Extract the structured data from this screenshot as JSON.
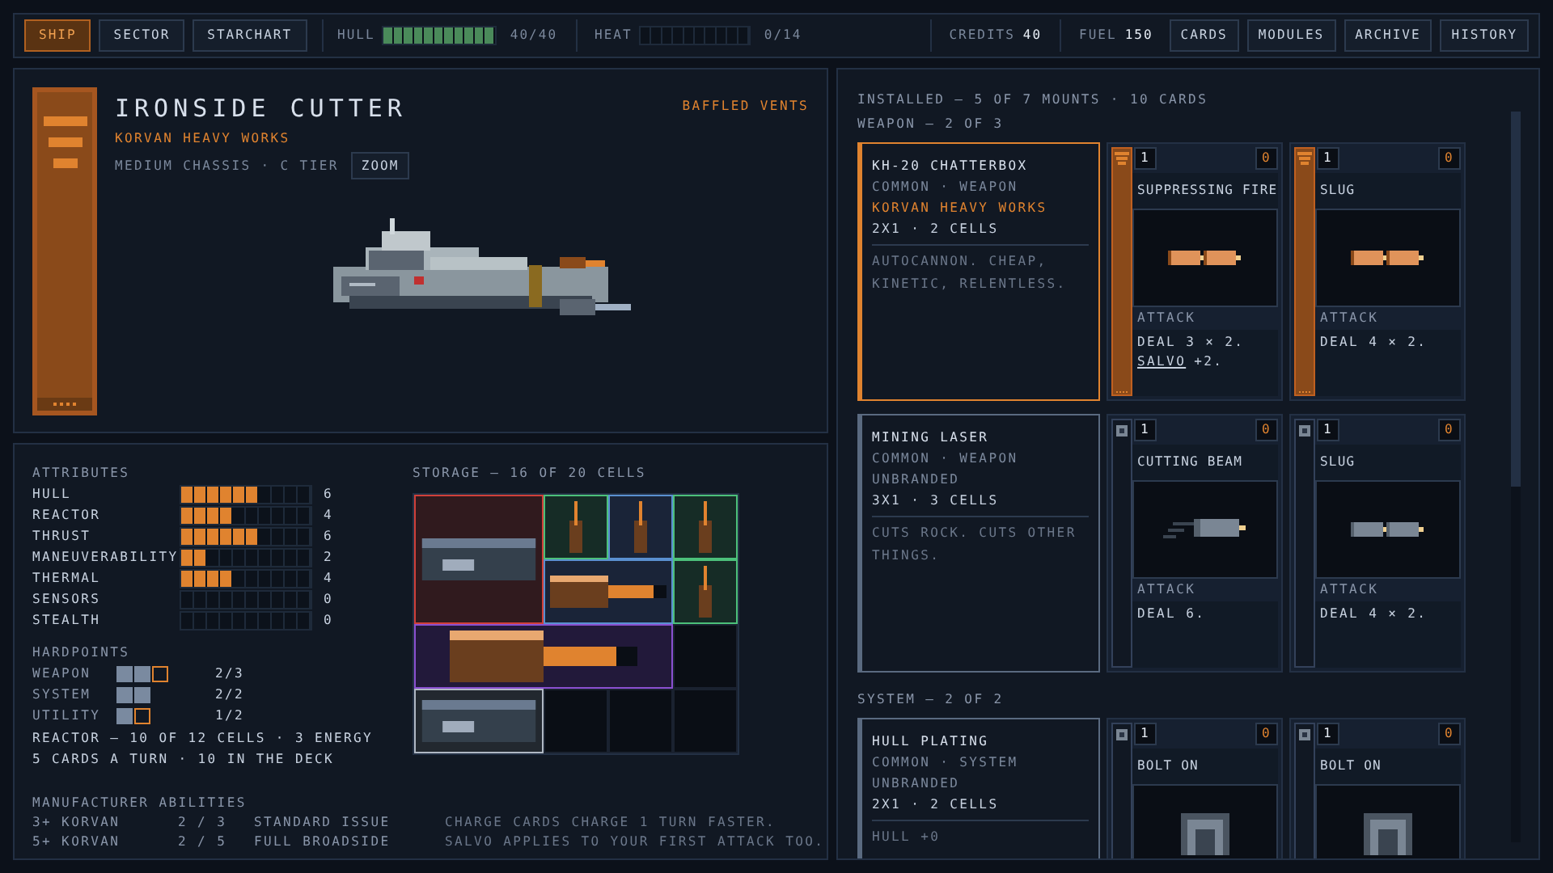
{
  "top_bar": {
    "tabs": [
      {
        "label": "SHIP",
        "selected": true
      },
      {
        "label": "SECTOR",
        "selected": false
      },
      {
        "label": "STARCHART",
        "selected": false
      }
    ],
    "hull": {
      "label": "HULL",
      "level": 1,
      "value": "40/40"
    },
    "heat": {
      "label": "HEAT",
      "level": 0,
      "value": "0/14"
    },
    "credits": {
      "label": "CREDITS",
      "value": "40"
    },
    "fuel": {
      "label": "FUEL",
      "value": "150"
    },
    "buttons": [
      "CARDS",
      "MODULES",
      "ARCHIVE",
      "HISTORY"
    ]
  },
  "ship": {
    "name": "IRONSIDE CUTTER",
    "maker": "KORVAN HEAVY WORKS",
    "chassis": "MEDIUM CHASSIS · C TIER",
    "zoom_button": "ZOOM",
    "trait": "BAFFLED VENTS"
  },
  "attributes": {
    "title": "ATTRIBUTES",
    "items": [
      {
        "name": "HULL",
        "level": 0.6,
        "value": "6"
      },
      {
        "name": "REACTOR",
        "level": 0.4,
        "value": "4"
      },
      {
        "name": "THRUST",
        "level": 0.6,
        "value": "6"
      },
      {
        "name": "MANEUVERABILITY",
        "level": 0.2,
        "value": "2"
      },
      {
        "name": "THERMAL",
        "level": 0.4,
        "value": "4"
      },
      {
        "name": "SENSORS",
        "level": 0,
        "value": "0"
      },
      {
        "name": "STEALTH",
        "level": 0,
        "value": "0"
      }
    ]
  },
  "hardpoints": {
    "title": "HARDPOINTS",
    "items": [
      {
        "name": "WEAPON",
        "slots": [
          {
            "used": true
          },
          {
            "used": true
          },
          {
            "used": false
          }
        ],
        "value": "2/3"
      },
      {
        "name": "SYSTEM",
        "slots": [
          {
            "used": true
          },
          {
            "used": true
          }
        ],
        "value": "2/2"
      },
      {
        "name": "UTILITY",
        "slots": [
          {
            "used": true
          },
          {
            "used": false
          }
        ],
        "value": "1/2"
      }
    ]
  },
  "reactor": "REACTOR — 10 OF 12 CELLS · 3 ENERGY",
  "deck": "5 CARDS A TURN · 10 IN THE DECK",
  "manufacturer": {
    "title": "MANUFACTURER ABILITIES",
    "rows": [
      {
        "name": "3+ KORVAN",
        "count": "2 / 3",
        "ability": "STANDARD ISSUE",
        "description": "CHARGE CARDS CHARGE 1 TURN FASTER."
      },
      {
        "name": "5+ KORVAN",
        "count": "2 / 5",
        "ability": "FULL BROADSIDE",
        "description": "SALVO APPLIES TO YOUR FIRST ATTACK TOO."
      }
    ]
  },
  "storage": {
    "title": "STORAGE — 16 OF 20 CELLS",
    "items": [
      {
        "kind": "big_plating",
        "color": "#d0403a"
      },
      {
        "kind": "shell",
        "color": "#4cc07a"
      },
      {
        "kind": "shell",
        "color": "#5a90d0"
      },
      {
        "kind": "shell",
        "color": "#4cc07a"
      },
      {
        "kind": "cannon",
        "color": "#5a90d0"
      },
      {
        "kind": "shell",
        "color": "#4cc07a"
      },
      {
        "kind": "big_cannon",
        "color": "#8a50d0"
      },
      {
        "kind": "empty"
      },
      {
        "kind": "plating",
        "color": "#b0b8c4"
      },
      {
        "kind": "empty"
      },
      {
        "kind": "empty"
      },
      {
        "kind": "empty"
      }
    ]
  },
  "installed": {
    "title": "INSTALLED — 5 OF 7 MOUNTS · 10 CARDS",
    "sections": [
      {
        "title": "WEAPON — 2 OF 3",
        "modules": [
          {
            "name": "KH-20 CHATTERBOX",
            "rarity": "COMMON · WEAPON",
            "maker": "KORVAN HEAVY WORKS",
            "branded": true,
            "size": "2X1 · 2 CELLS",
            "description": "AUTOCANNON. CHEAP, KINETIC, RELENTLESS.",
            "selected": true,
            "cards": [
              {
                "cost": "1",
                "charge": "0",
                "name": "SUPPRESSING FIRE",
                "kind": "twin_shell",
                "type": "ATTACK",
                "text": "DEAL 3 × 2.",
                "keyword": "SALVO",
                "keyword_text": "+2."
              },
              {
                "cost": "1",
                "charge": "0",
                "name": "SLUG",
                "kind": "twin_shell",
                "type": "ATTACK",
                "text": "DEAL 4 × 2."
              }
            ]
          },
          {
            "name": "MINING LASER",
            "rarity": "COMMON · WEAPON",
            "maker": "UNBRANDED",
            "branded": false,
            "size": "3X1 · 3 CELLS",
            "description": "CUTS ROCK. CUTS OTHER THINGS.",
            "selected": false,
            "cards": [
              {
                "cost": "1",
                "charge": "0",
                "name": "CUTTING BEAM",
                "kind": "beam",
                "type": "ATTACK",
                "text": "DEAL 6."
              },
              {
                "cost": "1",
                "charge": "0",
                "name": "SLUG",
                "kind": "twin_shell",
                "type": "ATTACK",
                "text": "DEAL 4 × 2."
              }
            ]
          }
        ]
      },
      {
        "title": "SYSTEM — 2 OF 2",
        "modules": [
          {
            "name": "HULL PLATING",
            "rarity": "COMMON · SYSTEM",
            "maker": "UNBRANDED",
            "branded": false,
            "size": "2X1 · 2 CELLS",
            "description": "HULL +0",
            "selected": false,
            "cards": [
              {
                "cost": "1",
                "charge": "0",
                "name": "BOLT ON",
                "kind": "plate"
              },
              {
                "cost": "1",
                "charge": "0",
                "name": "BOLT ON",
                "kind": "plate"
              }
            ]
          }
        ]
      }
    ]
  }
}
